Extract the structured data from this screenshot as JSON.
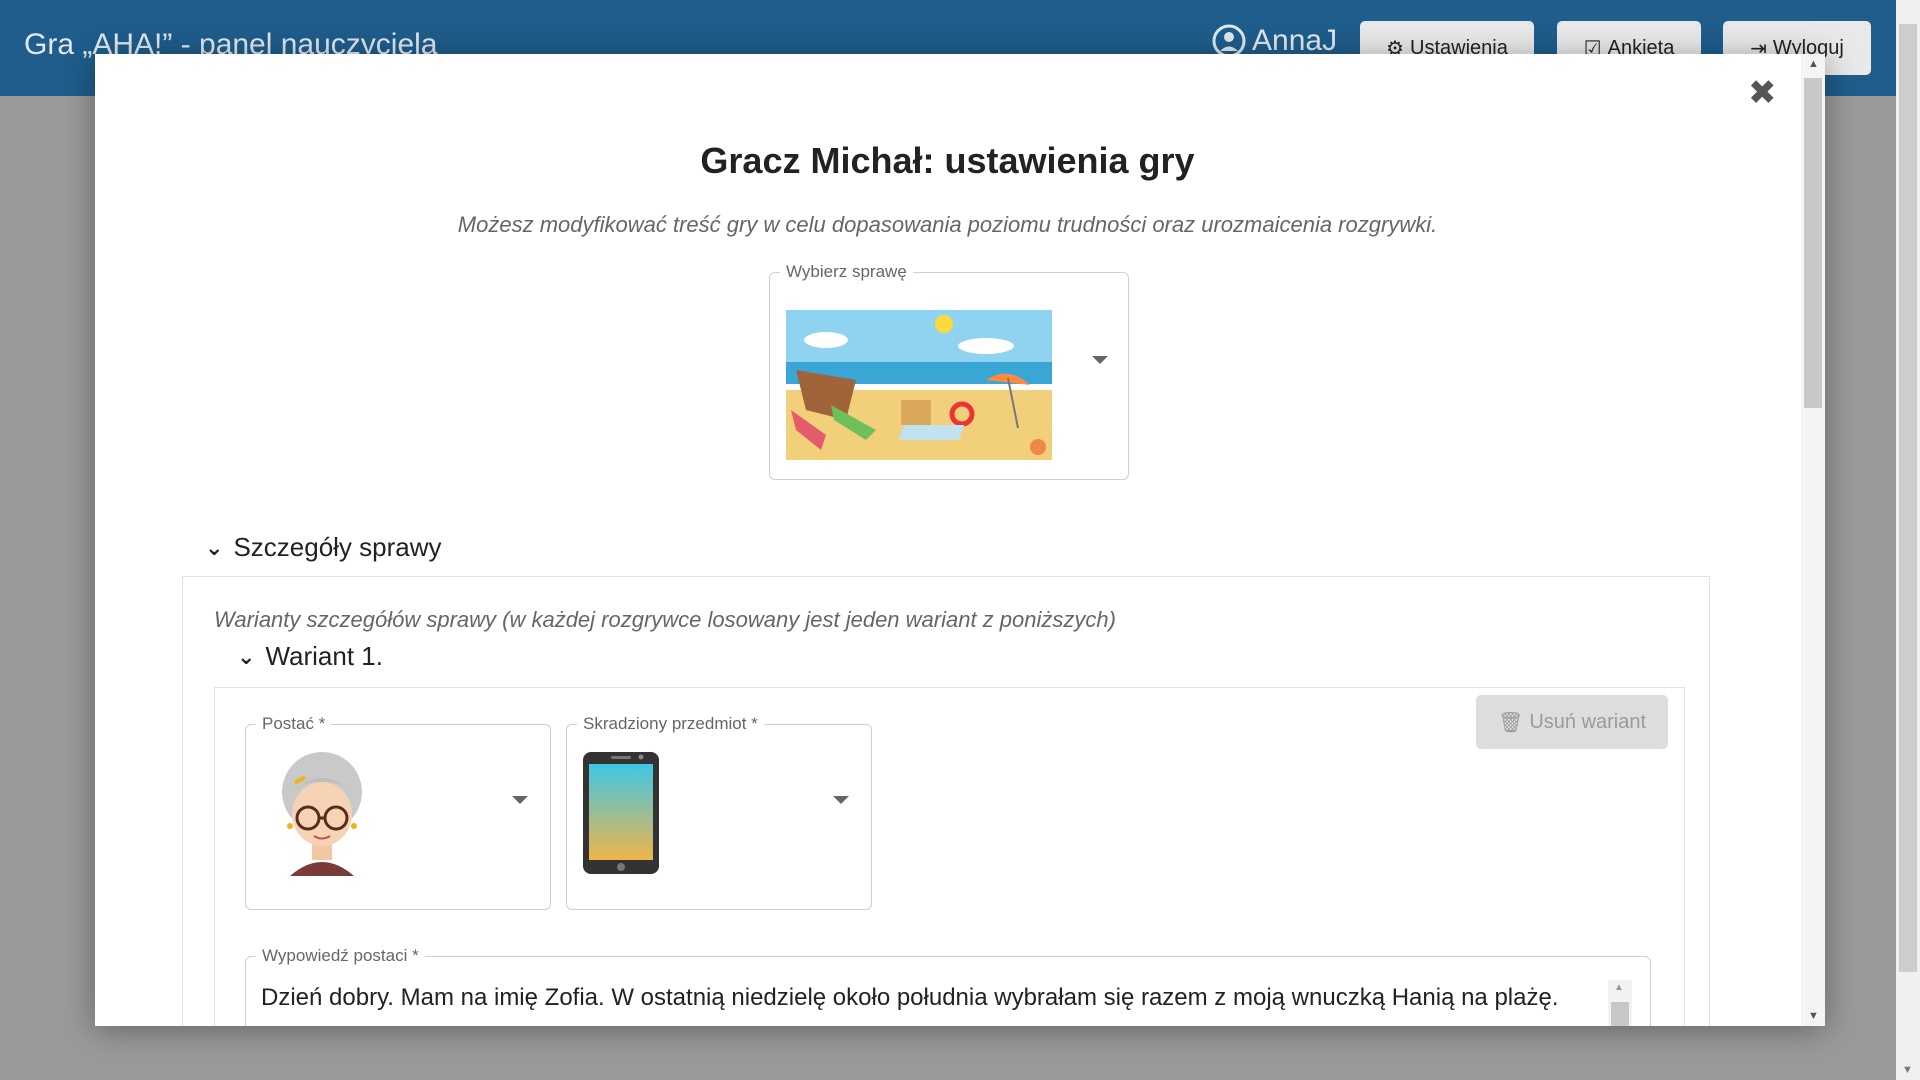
{
  "app": {
    "title": "Gra „AHA!” - panel nauczyciela",
    "user": "AnnaJ",
    "buttons": [
      {
        "label": "Ustawienia",
        "icon": "gear-icon"
      },
      {
        "label": "Ankieta",
        "icon": "checkbox-icon"
      },
      {
        "label": "Wyloguj",
        "icon": "logout-icon"
      }
    ]
  },
  "modal": {
    "title": "Gracz Michał: ustawienia gry",
    "subtitle": "Możesz modyfikować treść gry w celu dopasowania poziomu trudności oraz urozmaicenia rozgrywki.",
    "case_select": {
      "label": "Wybierz sprawę",
      "image": "beach-scene"
    },
    "details_section": {
      "title": "Szczegóły sprawy",
      "note": "Warianty szczegółów sprawy (w każdej rozgrywce losowany jest jeden wariant z poniższych)",
      "variant": {
        "title": "Wariant 1.",
        "delete_label": "Usuń wariant",
        "character": {
          "label": "Postać *",
          "image": "grandmother-avatar"
        },
        "stolen_item": {
          "label": "Skradziony przedmiot *",
          "image": "smartphone"
        },
        "statement": {
          "label": "Wypowiedź postaci *",
          "value": "Dzień dobry. Mam na imię Zofia. W ostatnią niedzielę około południa wybrałam się razem z moją wnuczką Hanią na plażę."
        }
      }
    }
  },
  "colors": {
    "appbar": "#1f5d8c",
    "modal_bg": "#ffffff",
    "overlay": "#8f8f8f"
  }
}
